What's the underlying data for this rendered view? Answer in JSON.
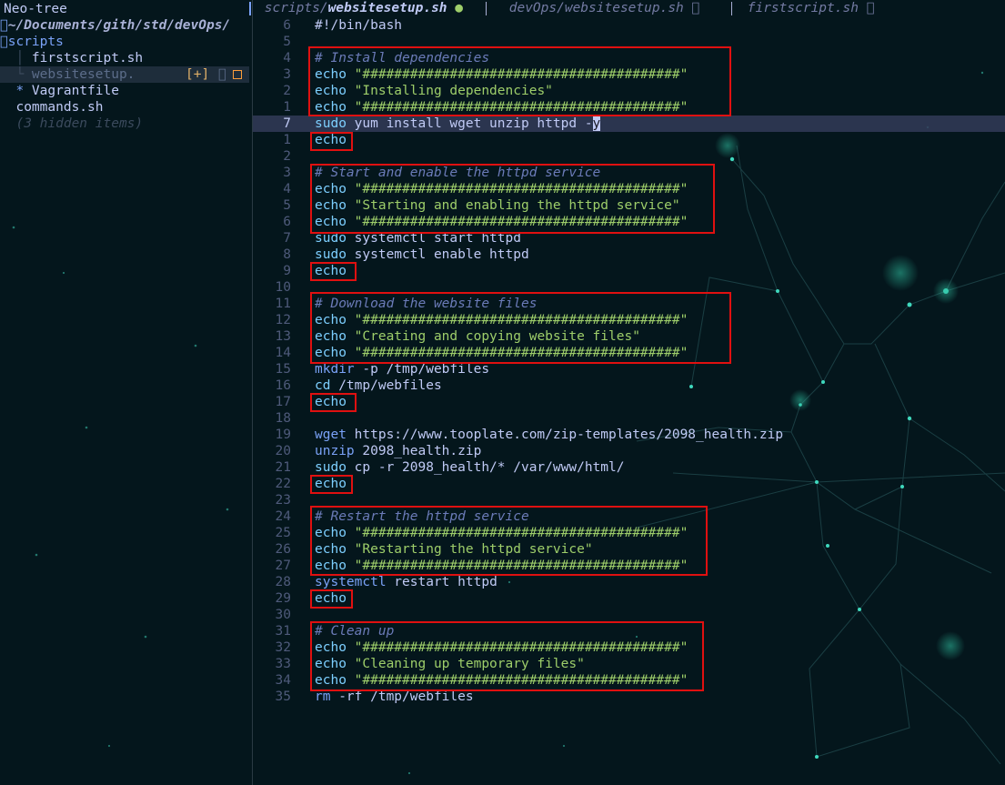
{
  "sidebar": {
    "title": "Neo-tree",
    "root_path": "~/Documents/gith/std/devOps/",
    "items": [
      {
        "label": "scripts"
      },
      {
        "label": "firstscript.sh"
      },
      {
        "label": "websitesetup.",
        "badge": "[+]"
      },
      {
        "label": "Vagrantfile"
      },
      {
        "label": "commands.sh"
      }
    ],
    "hidden_note": "(3 hidden items)"
  },
  "tabs": [
    {
      "dir": "scripts/",
      "name": "websitesetup.sh",
      "active": true,
      "modified_glyph": "●"
    },
    {
      "label": "devOps/websitesetup.sh",
      "close_glyph": "󰅖"
    },
    {
      "label": "firstscript.sh",
      "close_glyph": "󰅖"
    }
  ],
  "editor": {
    "current_line": 7,
    "lines": [
      {
        "n": "6",
        "tokens": [
          [
            "plain",
            "#!/bin/bash"
          ]
        ]
      },
      {
        "n": "5",
        "tokens": []
      },
      {
        "n": "4",
        "tokens": [
          [
            "cmt",
            "# Install dependencies"
          ]
        ]
      },
      {
        "n": "3",
        "tokens": [
          [
            "kw",
            "echo"
          ],
          [
            "plain",
            " "
          ],
          [
            "str",
            "\"########################################\""
          ]
        ]
      },
      {
        "n": "2",
        "tokens": [
          [
            "kw",
            "echo"
          ],
          [
            "plain",
            " "
          ],
          [
            "str",
            "\"Installing dependencies\""
          ]
        ]
      },
      {
        "n": "1",
        "tokens": [
          [
            "kw",
            "echo"
          ],
          [
            "plain",
            " "
          ],
          [
            "str",
            "\"########################################\""
          ]
        ]
      },
      {
        "n": "7",
        "tokens": [
          [
            "kw",
            "sudo"
          ],
          [
            "plain",
            " yum install wget unzip httpd -"
          ],
          [
            "cursor",
            "y"
          ]
        ]
      },
      {
        "n": "1",
        "tokens": [
          [
            "kw",
            "echo"
          ]
        ]
      },
      {
        "n": "2",
        "tokens": []
      },
      {
        "n": "3",
        "tokens": [
          [
            "cmt",
            "# Start and enable the httpd service"
          ]
        ]
      },
      {
        "n": "4",
        "tokens": [
          [
            "kw",
            "echo"
          ],
          [
            "plain",
            " "
          ],
          [
            "str",
            "\"########################################\""
          ]
        ]
      },
      {
        "n": "5",
        "tokens": [
          [
            "kw",
            "echo"
          ],
          [
            "plain",
            " "
          ],
          [
            "str",
            "\"Starting and enabling the httpd service\""
          ]
        ]
      },
      {
        "n": "6",
        "tokens": [
          [
            "kw",
            "echo"
          ],
          [
            "plain",
            " "
          ],
          [
            "str",
            "\"########################################\""
          ]
        ]
      },
      {
        "n": "7",
        "tokens": [
          [
            "kw",
            "sudo"
          ],
          [
            "plain",
            " systemctl start httpd"
          ]
        ]
      },
      {
        "n": "8",
        "tokens": [
          [
            "kw",
            "sudo"
          ],
          [
            "plain",
            " systemctl enable httpd"
          ]
        ]
      },
      {
        "n": "9",
        "tokens": [
          [
            "kw",
            "echo"
          ]
        ]
      },
      {
        "n": "10",
        "tokens": []
      },
      {
        "n": "11",
        "tokens": [
          [
            "cmt",
            "# Download the website files"
          ]
        ]
      },
      {
        "n": "12",
        "tokens": [
          [
            "kw",
            "echo"
          ],
          [
            "plain",
            " "
          ],
          [
            "str",
            "\"########################################\""
          ]
        ]
      },
      {
        "n": "13",
        "tokens": [
          [
            "kw",
            "echo"
          ],
          [
            "plain",
            " "
          ],
          [
            "str",
            "\"Creating and copying website files\""
          ]
        ]
      },
      {
        "n": "14",
        "tokens": [
          [
            "kw",
            "echo"
          ],
          [
            "plain",
            " "
          ],
          [
            "str",
            "\"########################################\""
          ]
        ]
      },
      {
        "n": "15",
        "tokens": [
          [
            "fn",
            "mkdir"
          ],
          [
            "plain",
            " -p /tmp/webfiles"
          ]
        ]
      },
      {
        "n": "16",
        "tokens": [
          [
            "kw",
            "cd"
          ],
          [
            "plain",
            " /tmp/webfiles"
          ]
        ]
      },
      {
        "n": "17",
        "tokens": [
          [
            "kw",
            "echo"
          ]
        ]
      },
      {
        "n": "18",
        "tokens": []
      },
      {
        "n": "19",
        "tokens": [
          [
            "fn",
            "wget"
          ],
          [
            "plain",
            " https://www.tooplate.com/zip-templates/2098_health.zip"
          ]
        ]
      },
      {
        "n": "20",
        "tokens": [
          [
            "fn",
            "unzip"
          ],
          [
            "plain",
            " 2098_health.zip"
          ]
        ]
      },
      {
        "n": "21",
        "tokens": [
          [
            "kw",
            "sudo"
          ],
          [
            "plain",
            " cp -r 2098_health/* /var/www/html/"
          ]
        ]
      },
      {
        "n": "22",
        "tokens": [
          [
            "kw",
            "echo"
          ]
        ]
      },
      {
        "n": "23",
        "tokens": []
      },
      {
        "n": "24",
        "tokens": [
          [
            "cmt",
            "# Restart the httpd service"
          ]
        ]
      },
      {
        "n": "25",
        "tokens": [
          [
            "kw",
            "echo"
          ],
          [
            "plain",
            " "
          ],
          [
            "str",
            "\"########################################\""
          ]
        ]
      },
      {
        "n": "26",
        "tokens": [
          [
            "kw",
            "echo"
          ],
          [
            "plain",
            " "
          ],
          [
            "str",
            "\"Restarting the httpd service\""
          ]
        ]
      },
      {
        "n": "27",
        "tokens": [
          [
            "kw",
            "echo"
          ],
          [
            "plain",
            " "
          ],
          [
            "str",
            "\"########################################\""
          ]
        ]
      },
      {
        "n": "28",
        "tokens": [
          [
            "fn",
            "systemctl"
          ],
          [
            "plain",
            " restart httpd"
          ]
        ]
      },
      {
        "n": "29",
        "tokens": [
          [
            "kw",
            "echo"
          ]
        ]
      },
      {
        "n": "30",
        "tokens": []
      },
      {
        "n": "31",
        "tokens": [
          [
            "cmt",
            "# Clean up"
          ]
        ]
      },
      {
        "n": "32",
        "tokens": [
          [
            "kw",
            "echo"
          ],
          [
            "plain",
            " "
          ],
          [
            "str",
            "\"########################################\""
          ]
        ]
      },
      {
        "n": "33",
        "tokens": [
          [
            "kw",
            "echo"
          ],
          [
            "plain",
            " "
          ],
          [
            "str",
            "\"Cleaning up temporary files\""
          ]
        ]
      },
      {
        "n": "34",
        "tokens": [
          [
            "kw",
            "echo"
          ],
          [
            "plain",
            " "
          ],
          [
            "str",
            "\"########################################\""
          ]
        ]
      },
      {
        "n": "35",
        "tokens": [
          [
            "fn",
            "rm"
          ],
          [
            "plain",
            " -rf /tmp/webfiles"
          ]
        ]
      }
    ]
  },
  "colors": {
    "annotation_box": "#e01010",
    "background": "#04161c",
    "string": "#9ece6a",
    "keyword": "#7dcfff",
    "comment": "#6b7bb8"
  }
}
